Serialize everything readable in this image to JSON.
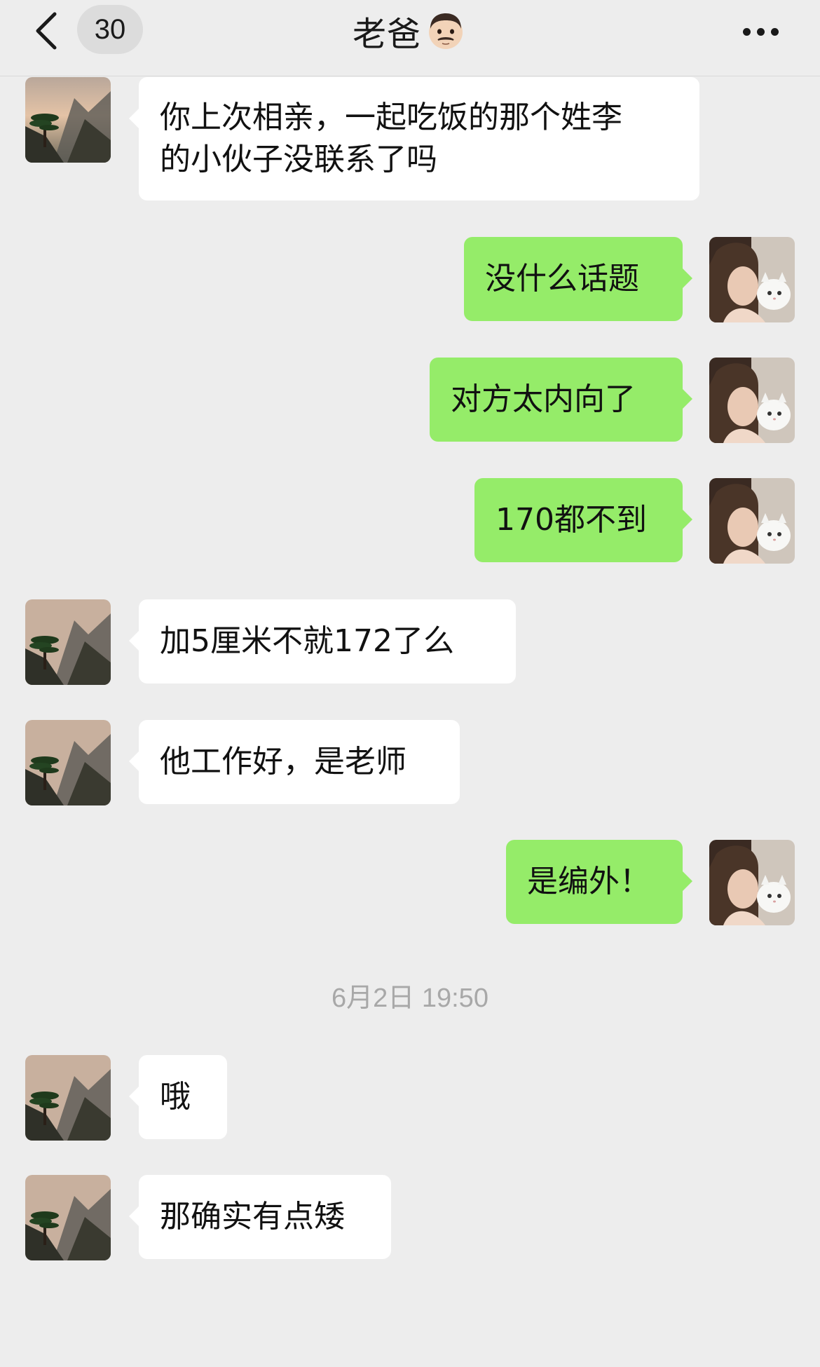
{
  "header": {
    "back_icon": "chevron-left-icon",
    "unread_count": "30",
    "title": "老爸",
    "title_icon": "man-face-emoji-icon",
    "more_icon": "more-dots-icon"
  },
  "contact_avatar": "mountain-pine-avatar",
  "self_avatar": "girl-with-cat-avatar",
  "messages": [
    {
      "side": "left",
      "text": "你上次相亲，一起吃饭的那个姓李\n的小伙子没联系了吗"
    },
    {
      "side": "right",
      "text": "没什么话题"
    },
    {
      "side": "right",
      "text": "对方太内向了"
    },
    {
      "side": "right",
      "text": "170都不到"
    },
    {
      "side": "left",
      "text": "加5厘米不就172了么"
    },
    {
      "side": "left",
      "text": "他工作好，是老师"
    },
    {
      "side": "right",
      "text": "是编外！"
    },
    {
      "side": "left",
      "text": "哦"
    },
    {
      "side": "left",
      "text": "那确实有点矮"
    }
  ],
  "timestamp": "6月2日 19:50",
  "colors": {
    "background": "#EDEDED",
    "bubble_incoming": "#FFFFFF",
    "bubble_outgoing": "#95EC69",
    "timestamp": "#A8A8A8"
  }
}
